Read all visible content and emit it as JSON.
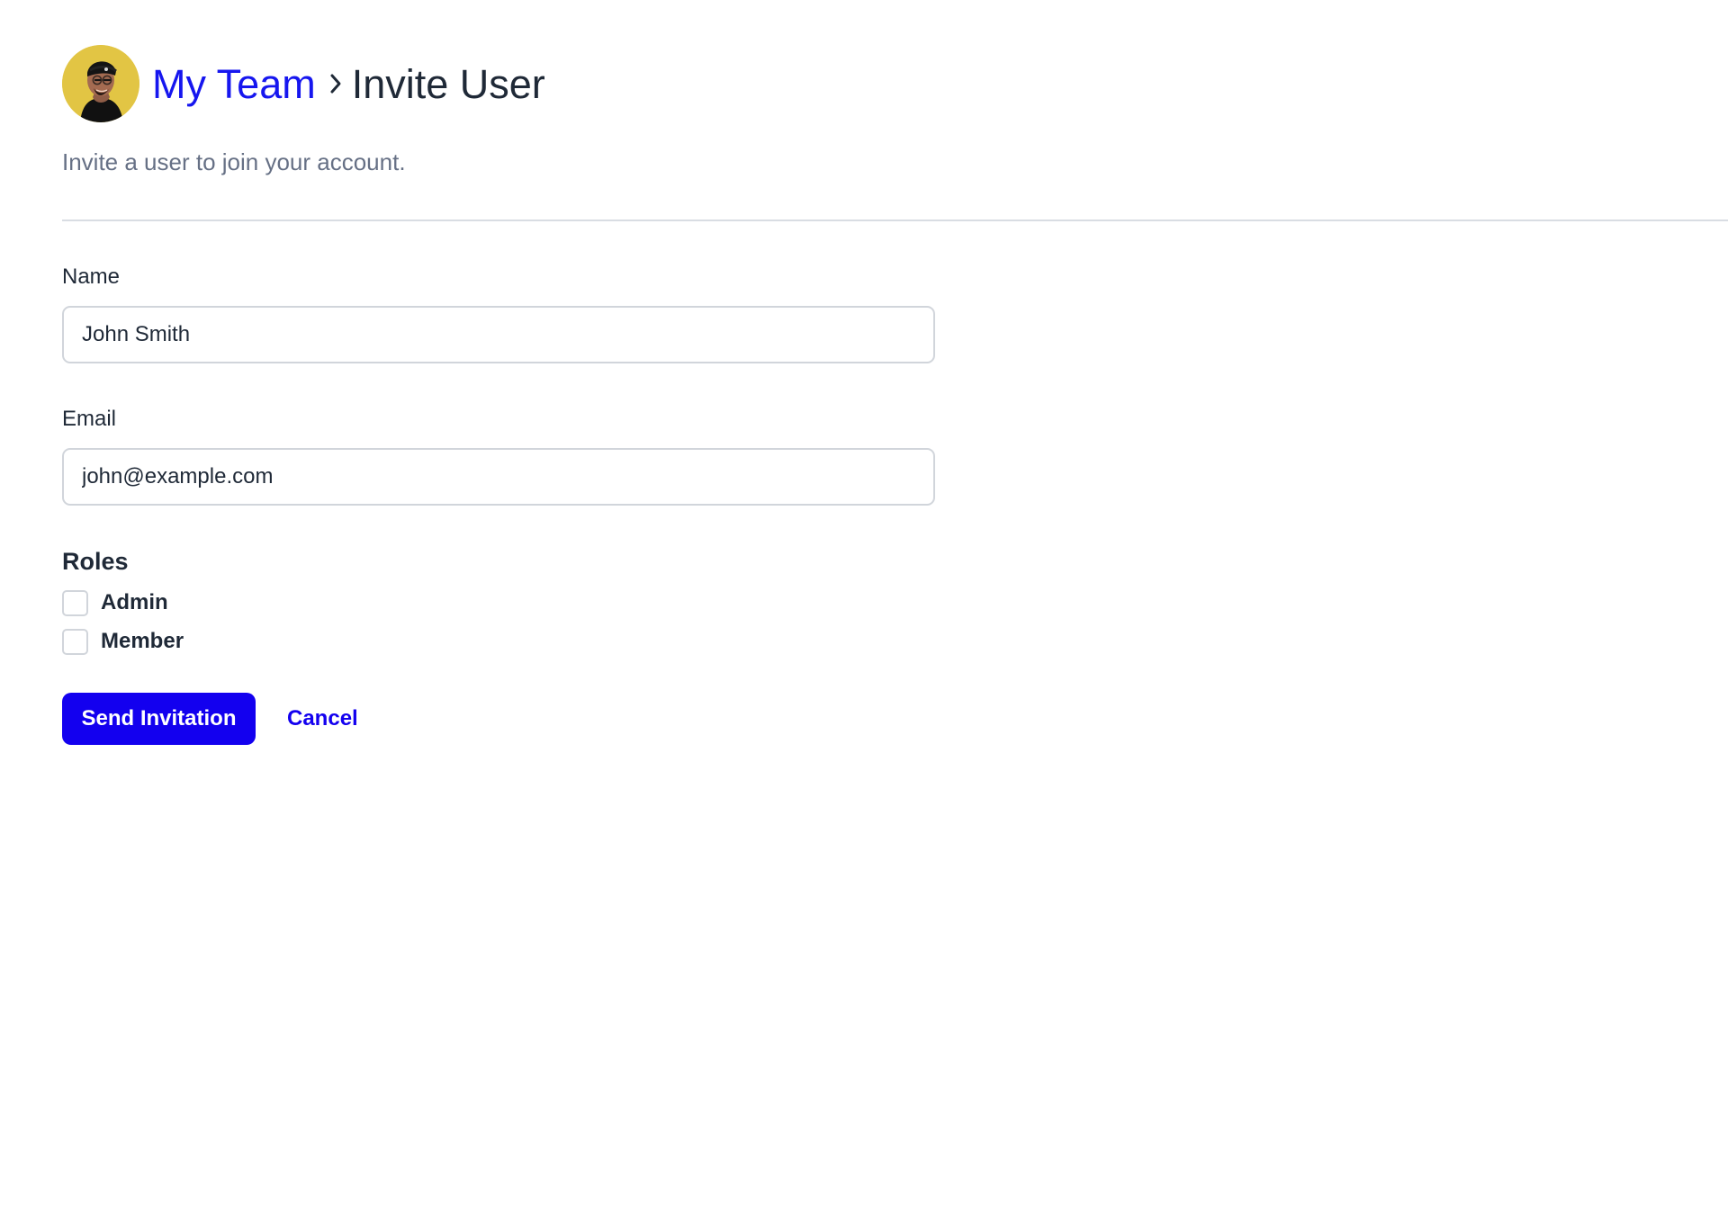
{
  "header": {
    "avatar_icon": "user-avatar-icon",
    "breadcrumb_parent": "My Team",
    "breadcrumb_separator_icon": "chevron-right-icon",
    "breadcrumb_current": "Invite User"
  },
  "subtitle": "Invite a user to join your account.",
  "form": {
    "name": {
      "label": "Name",
      "value": "John Smith"
    },
    "email": {
      "label": "Email",
      "value": "john@example.com"
    },
    "roles": {
      "title": "Roles",
      "options": [
        {
          "label": "Admin",
          "checked": false
        },
        {
          "label": "Member",
          "checked": false
        }
      ]
    },
    "actions": {
      "submit_label": "Send Invitation",
      "cancel_label": "Cancel"
    }
  },
  "colors": {
    "primary": "#1300EF",
    "text": "#1F2937",
    "muted": "#667085",
    "border": "#D1D5DB",
    "avatar_background": "#E2C544"
  }
}
